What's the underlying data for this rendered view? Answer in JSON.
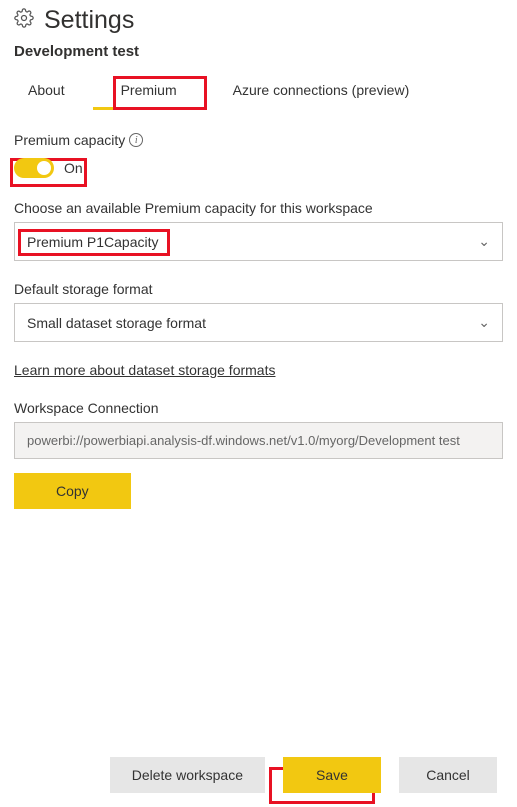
{
  "header": {
    "title": "Settings",
    "workspace_name": "Development test"
  },
  "tabs": {
    "about": "About",
    "premium": "Premium",
    "azure": "Azure connections (preview)"
  },
  "premium": {
    "capacity_label": "Premium capacity",
    "toggle_state": "On",
    "choose_label": "Choose an available Premium capacity for this workspace",
    "selected_capacity": "Premium  P1Capacity",
    "storage_label": "Default storage format",
    "selected_storage": "Small dataset storage format",
    "learn_more": "Learn more about dataset storage formats",
    "connection_label": "Workspace Connection",
    "connection_value": "powerbi://powerbiapi.analysis-df.windows.net/v1.0/myorg/Development test",
    "copy_label": "Copy"
  },
  "footer": {
    "delete": "Delete workspace",
    "save": "Save",
    "cancel": "Cancel"
  }
}
